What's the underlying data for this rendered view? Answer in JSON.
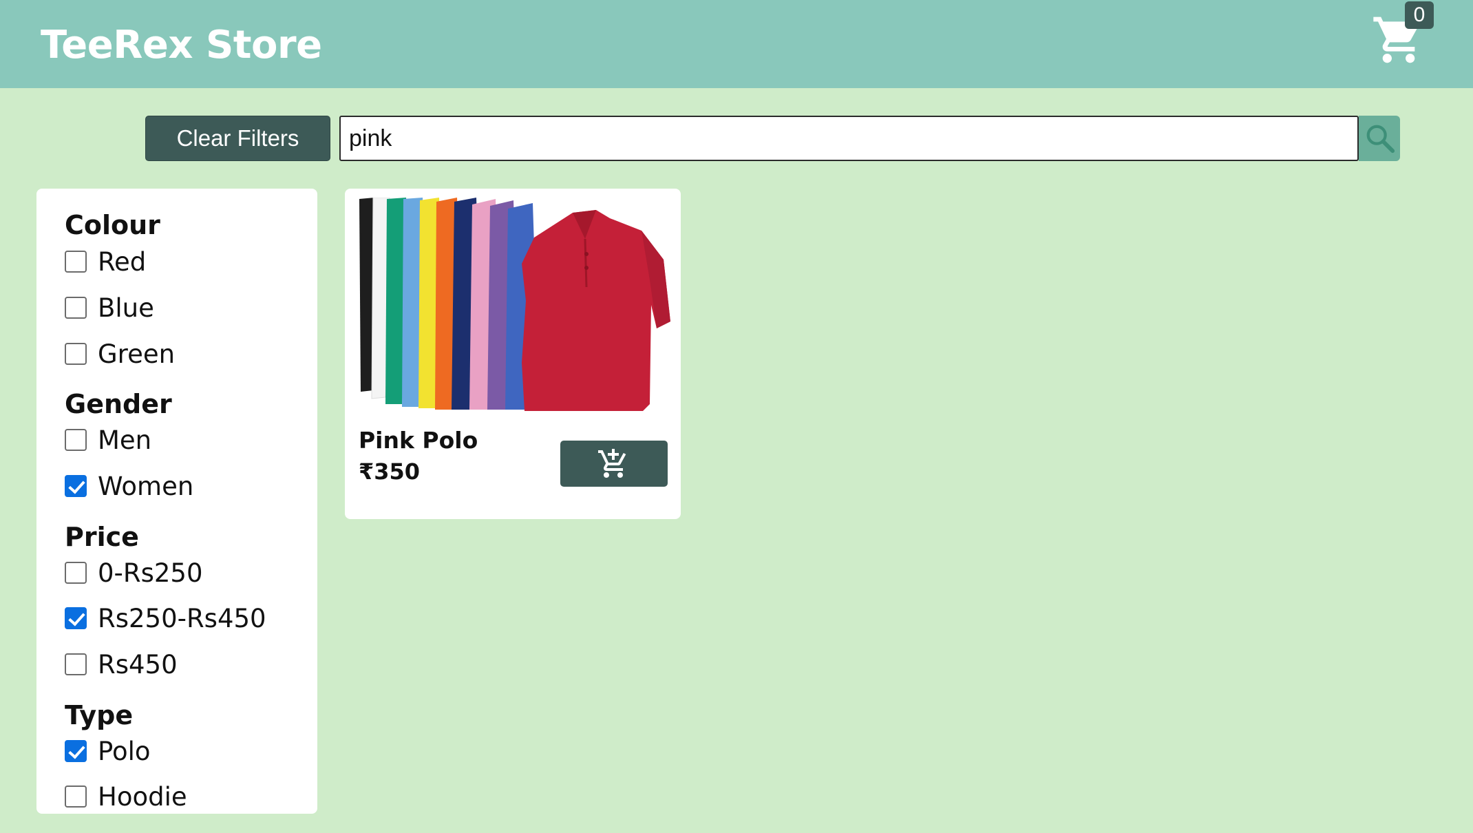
{
  "header": {
    "brand": "TeeRex Store",
    "cart_count": "0",
    "cart_icon": "shopping-cart-icon"
  },
  "toolbar": {
    "clear_filters_label": "Clear Filters",
    "search_value": "pink",
    "search_icon": "search-icon"
  },
  "filters": {
    "groups": [
      {
        "heading": "Colour",
        "options": [
          {
            "label": "Red",
            "checked": false
          },
          {
            "label": "Blue",
            "checked": false
          },
          {
            "label": "Green",
            "checked": false
          }
        ]
      },
      {
        "heading": "Gender",
        "options": [
          {
            "label": "Men",
            "checked": false
          },
          {
            "label": "Women",
            "checked": true
          }
        ]
      },
      {
        "heading": "Price",
        "options": [
          {
            "label": "0-Rs250",
            "checked": false
          },
          {
            "label": "Rs250-Rs450",
            "checked": true
          },
          {
            "label": "Rs450",
            "checked": false
          }
        ]
      },
      {
        "heading": "Type",
        "options": [
          {
            "label": "Polo",
            "checked": true
          },
          {
            "label": "Hoodie",
            "checked": false
          }
        ]
      }
    ]
  },
  "products": [
    {
      "name": "Pink Polo",
      "price": "₹350",
      "add_icon": "add-to-cart-icon"
    }
  ],
  "colors": {
    "header_bg": "#89c8bb",
    "page_bg": "#cfecc9",
    "button_dark": "#3d5a57",
    "search_button": "#6aaf9a",
    "checkbox_checked": "#0a6fe0"
  }
}
